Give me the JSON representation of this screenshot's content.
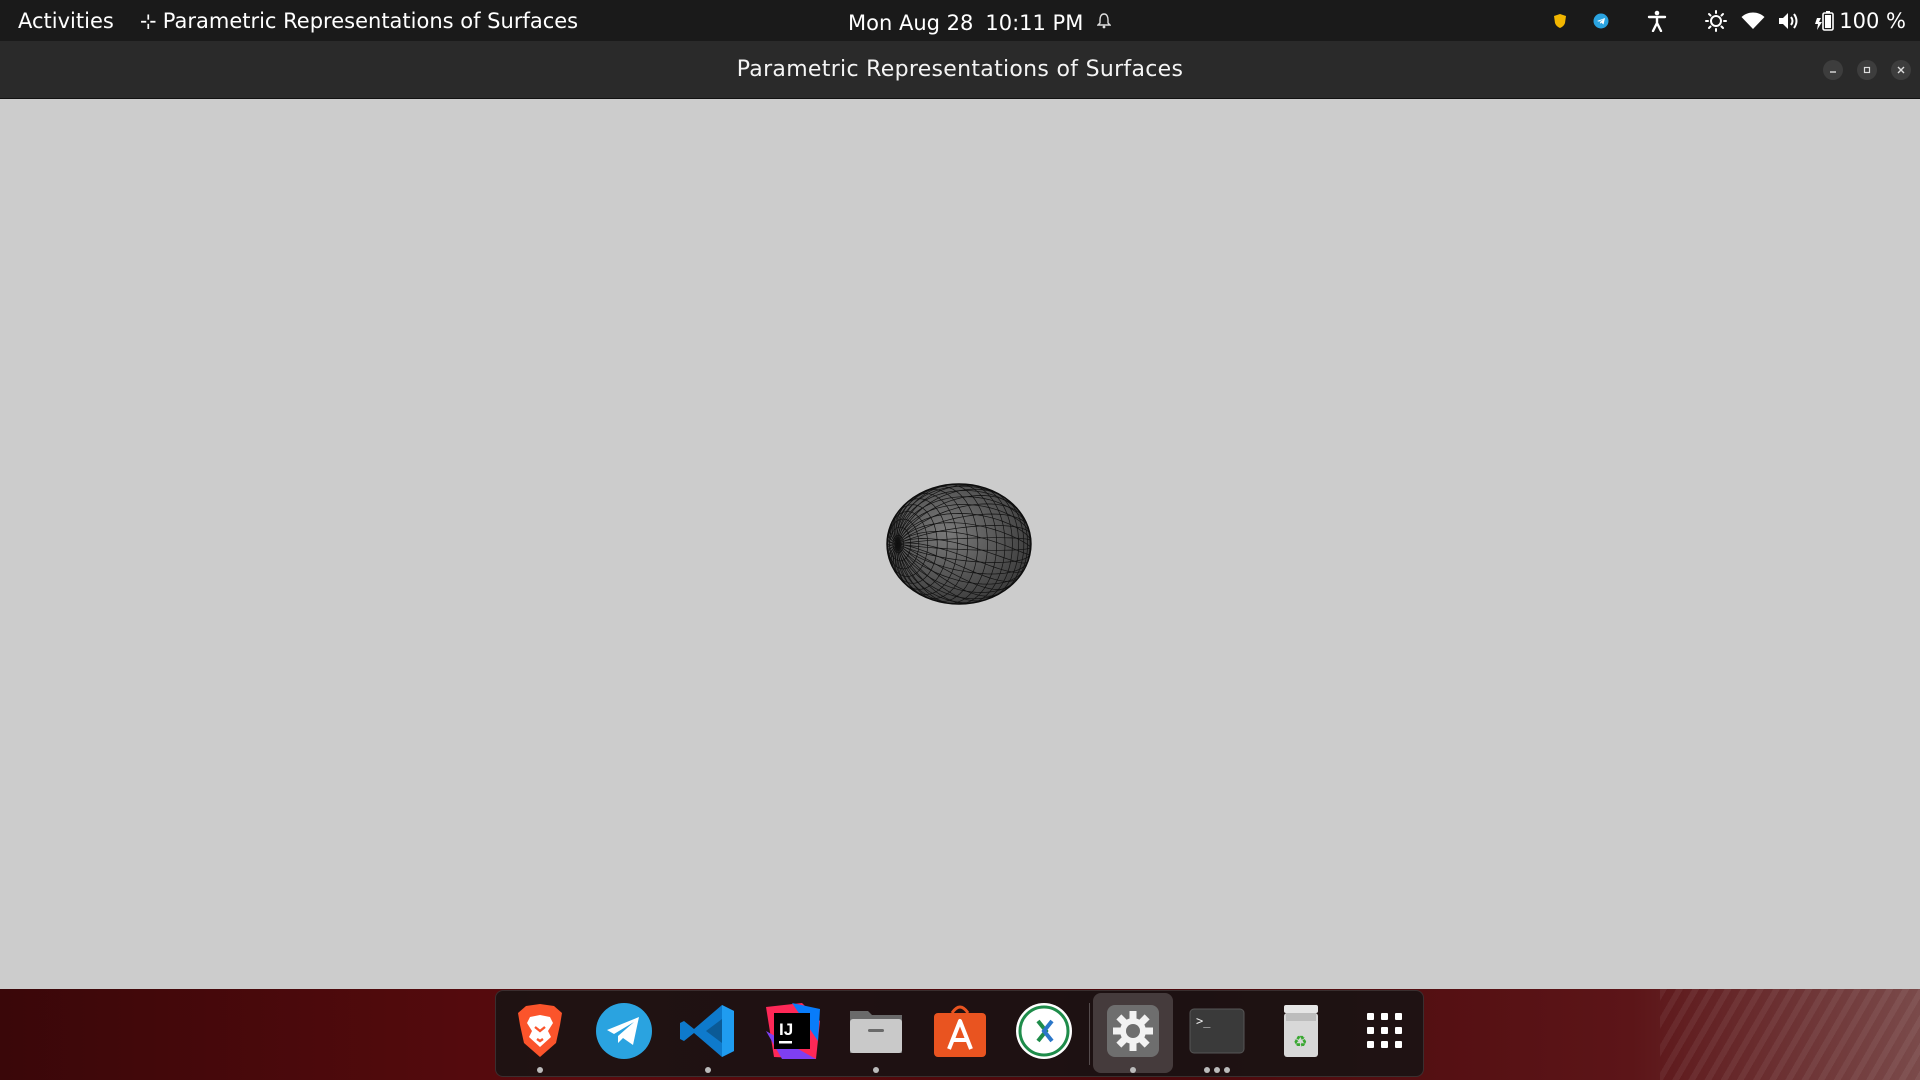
{
  "topbar": {
    "activities_label": "Activities",
    "app_name": "Parametric Representations of Surfaces",
    "date": "Mon Aug 28",
    "time": "10:11 PM",
    "battery_percent": "100 %",
    "icons": [
      "shield-icon",
      "telegram-tray-icon",
      "accessibility-icon",
      "brightness-icon",
      "wifi-icon",
      "volume-icon",
      "battery-icon",
      "bell-icon"
    ]
  },
  "window": {
    "title": "Parametric Representations of Surfaces",
    "controls": [
      "minimize",
      "maximize",
      "close"
    ],
    "background_color": "#cccccc"
  },
  "canvas": {
    "object": "wireframe ellipsoid",
    "mesh_color": "#1a1a1a",
    "fill_color": "#444444"
  },
  "dock": {
    "apps": [
      {
        "name": "brave-browser",
        "running": true
      },
      {
        "name": "telegram",
        "running": false
      },
      {
        "name": "visual-studio-code",
        "running": true
      },
      {
        "name": "intellij-idea",
        "running": false
      },
      {
        "name": "files",
        "running": true
      },
      {
        "name": "app-store",
        "running": false
      },
      {
        "name": "remote-desktop",
        "running": false
      },
      {
        "name": "settings",
        "running": true,
        "active": true
      },
      {
        "name": "terminal",
        "running": true,
        "windows": 3
      },
      {
        "name": "trash",
        "running": false
      },
      {
        "name": "show-applications",
        "running": false
      }
    ],
    "terminal_label": ">_",
    "intellij_label": "IJ"
  }
}
